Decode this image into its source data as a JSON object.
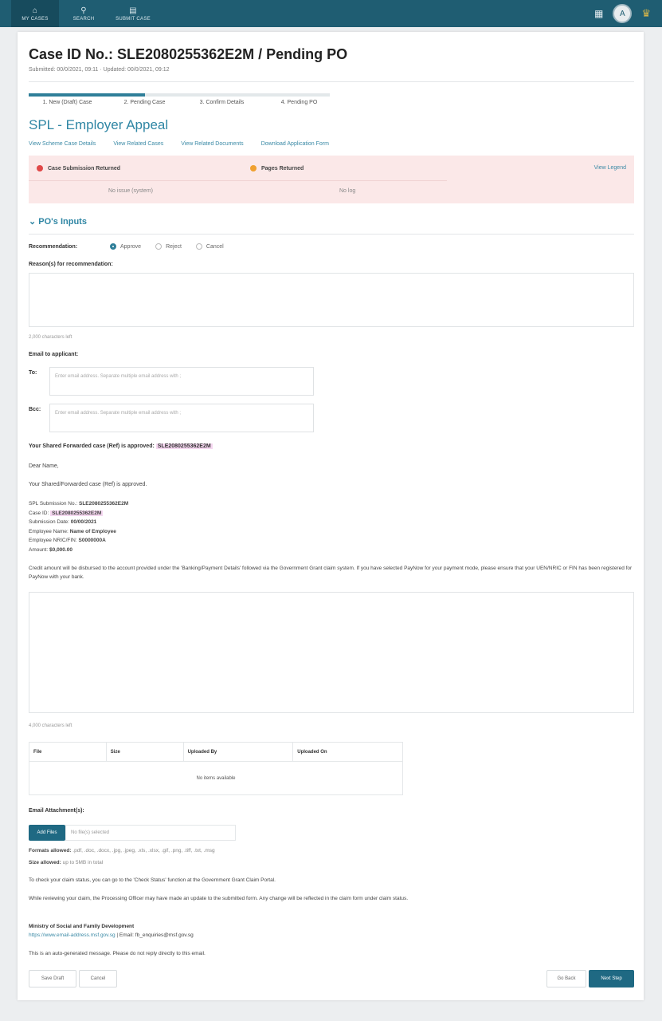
{
  "nav": {
    "items": [
      {
        "icon": "home-icon",
        "glyph": "⌂",
        "label": "My Cases"
      },
      {
        "icon": "search-icon",
        "glyph": "⚲",
        "label": "Search"
      },
      {
        "icon": "folder-icon",
        "glyph": "▤",
        "label": "Submit Case"
      }
    ],
    "avatar_initial": "A"
  },
  "case": {
    "title": "Case ID No.: SLE2080255362E2M / Pending PO",
    "subtitle": "Submitted: 00/0/2021, 09:11 · Updated: 00/0/2021, 09:12"
  },
  "steps": [
    "1. New (Draft) Case",
    "2. Pending Case",
    "3. Confirm Details",
    "4. Pending PO"
  ],
  "scheme": {
    "title": "SPL - Employer Appeal",
    "links": [
      "View Scheme Case Details",
      "View Related Cases",
      "View Related Documents",
      "Download Application Form"
    ]
  },
  "status": {
    "flags": [
      {
        "label": "Case Submission Returned",
        "color": "#e04848",
        "value": "No issue (system)"
      },
      {
        "label": "Pages Returned",
        "color": "#f0a030",
        "value": "No log"
      }
    ],
    "legend_link": "View Legend"
  },
  "inputs": {
    "section_title": "PO's Inputs",
    "recommendation_label": "Recommendation:",
    "options": [
      {
        "label": "Approve",
        "selected": true
      },
      {
        "label": "Reject",
        "selected": false
      },
      {
        "label": "Cancel",
        "selected": false
      }
    ],
    "reasons_label": "Reason(s) for recommendation:",
    "reasons_counter": "2,000 characters left",
    "email_label": "Email to applicant:",
    "to_label": "To:",
    "to_placeholder": "Enter email address. Separate multiple email address with ;",
    "bcc_label": "Bcc:",
    "bcc_placeholder": "Enter email address. Separate multiple email address with ;"
  },
  "email": {
    "subject_prefix": "Your Shared Forwarded case (Ref) is approved: ",
    "subject_ref": "SLE2080255362E2M",
    "greeting": "Dear Name,",
    "intro": "Your Shared/Forwarded case (Ref) is approved.",
    "fields": [
      {
        "k": "SPL Submission No.:",
        "v": "SLE2080255362E2M"
      },
      {
        "k": "Case ID:",
        "v": "SLE2080255362E2M"
      },
      {
        "k": "Submission Date:",
        "v": "00/00/2021"
      },
      {
        "k": "Employee Name:",
        "v": "Name of Employee"
      },
      {
        "k": "Employee NRIC/FIN:",
        "v": "S0000000A"
      },
      {
        "k": "Amount:",
        "v": "$0,000.00"
      }
    ],
    "body": "Credit amount will be disbursed to the account provided under the 'Banking/Payment Details' followed via the Government Grant claim system. If you have selected PayNow for your payment mode, please ensure that your UEN/NRIC or FIN has been registered for PayNow with your bank.",
    "counter": "4,000 characters left"
  },
  "documents": {
    "headers": [
      "File",
      "Size",
      "Uploaded By",
      "Uploaded On"
    ],
    "empty": "No items available"
  },
  "attachments": {
    "label": "Email Attachment(s):",
    "choose": "Add Files",
    "placeholder": "No file(s) selected",
    "formats_label": "Formats allowed:",
    "formats": ".pdf, .doc, .docx, .jpg, .jpeg, .xls, .xlsx, .gif, .png, .tiff, .txt, .msg",
    "size_label": "Size allowed:",
    "size": "up to 5MB in total"
  },
  "notes": {
    "line1": "To check your claim status, you can go to the 'Check Status' function at the Government Grant Claim Portal.",
    "line2": "While reviewing your claim, the Processing Officer may have made an update to the submitted form. Any change will be reflected in the claim form under claim status.",
    "org": "Ministry of Social and Family Development",
    "org_email": "https://www.email-address.msf.gov.sg",
    "org_rest": " | Email: fb_enquiries@msf.gov.sg",
    "noreply": "This is an auto-generated message. Please do not reply directly to this email."
  },
  "buttons": {
    "save_draft": "Save Draft",
    "cancel": "Cancel",
    "go_back": "Go Back",
    "next": "Next Step"
  }
}
